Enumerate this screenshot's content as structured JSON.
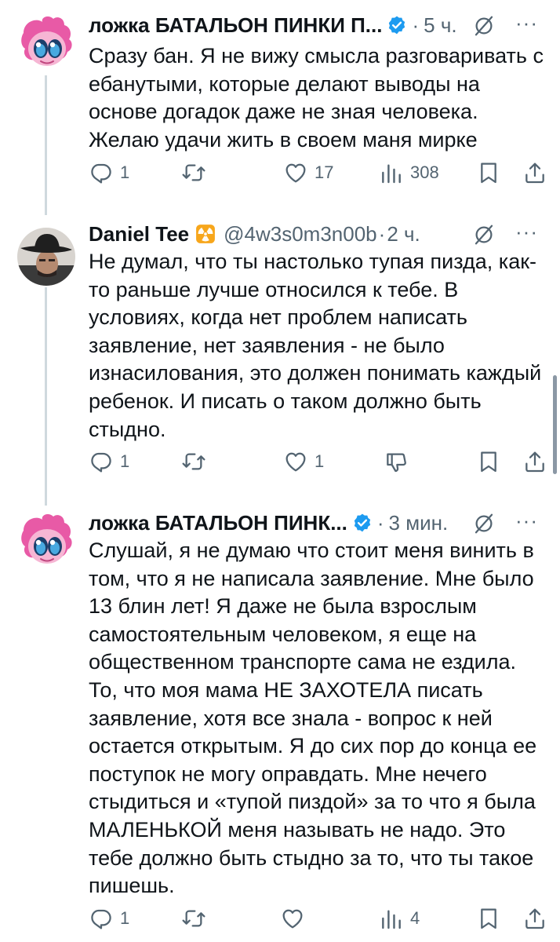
{
  "tweets": [
    {
      "name": "ложка БАТАЛЬОН ПИНКИ П...",
      "handle": "",
      "time": "5 ч.",
      "verified": true,
      "text": "Сразу бан. Я не вижу смысла разговаривать с ебанутыми, которые делают выводы на основе догадок даже не зная человека. Желаю удачи жить в своем маня мирке",
      "actions": {
        "replies": "1",
        "reposts": "",
        "likes": "17",
        "views": "308"
      }
    },
    {
      "name": "Daniel Tee",
      "handle": "@4w3s0m3n00b",
      "time": "2 ч.",
      "verified": false,
      "emoji": "radioactive-icon",
      "text": "Не думал, что ты настолько тупая пизда, как-то раньше лучше относился к тебе. В условиях, когда нет проблем написать заявление, нет заявления - не было изнасилования, это должен понимать каждый ребенок. И писать о таком должно быть стыдно.",
      "actions": {
        "replies": "1",
        "reposts": "",
        "likes": "1"
      }
    },
    {
      "name": "ложка БАТАЛЬОН ПИНК...",
      "handle": "",
      "time": "3 мин.",
      "verified": true,
      "text": "Слушай, я не думаю что стоит меня винить в том, что я не написала заявление. Мне было 13 блин лет! Я даже не была взрослым самостоятельным человеком, я еще на общественном транспорте сама не ездила. То, что моя мама НЕ ЗАХОТЕЛА писать заявление, хотя все знала - вопрос к ней остается открытым. Я до сих пор до конца ее поступок не могу оправдать. Мне нечего стыдиться и «тупой пиздой» за то что я была МАЛЕНЬКОЙ меня называть не надо. Это тебе должно быть стыдно за то, что ты такое пишешь.",
      "actions": {
        "replies": "1",
        "reposts": "",
        "likes": "",
        "views": "4"
      }
    }
  ],
  "ui": {
    "dot": "·",
    "more": "···"
  },
  "colors": {
    "text": "#0f1419",
    "muted": "#536471",
    "verified": "#1d9bf0",
    "thread_line": "#cfd9de",
    "avatar_pink": "#f6b6d4"
  }
}
